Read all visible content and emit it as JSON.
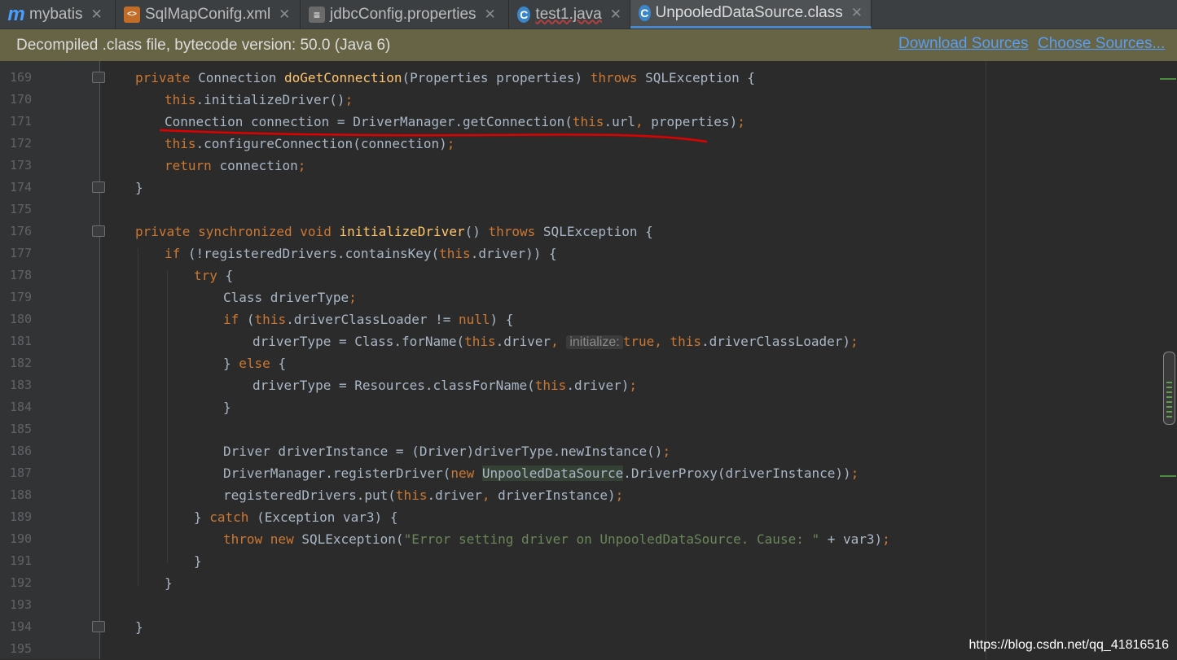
{
  "tabs": [
    {
      "icon": "m",
      "label": "mybatis",
      "active": false
    },
    {
      "icon": "<>",
      "label": "SqlMapConifg.xml",
      "active": false
    },
    {
      "icon": "≡",
      "label": "jdbcConfig.properties",
      "active": false
    },
    {
      "icon": "C",
      "label": "test1.java",
      "active": false
    },
    {
      "icon": "C",
      "label": "UnpooledDataSource.class",
      "active": true
    }
  ],
  "banner": {
    "message": "Decompiled .class file, bytecode version: 50.0 (Java 6)",
    "download_sources": "Download Sources",
    "choose_sources": "Choose Sources..."
  },
  "code": {
    "line_numbers": [
      "169",
      "170",
      "171",
      "172",
      "173",
      "174",
      "175",
      "176",
      "177",
      "178",
      "179",
      "180",
      "181",
      "182",
      "183",
      "184",
      "185",
      "186",
      "187",
      "188",
      "189",
      "190",
      "191",
      "192",
      "193",
      "194",
      "195"
    ],
    "l169": {
      "kw1": "private ",
      "t1": "Connection ",
      "fn": "doGetConnection",
      "t2": "(Properties properties) ",
      "kw2": "throws ",
      "t3": "SQLException {"
    },
    "l170": {
      "kw1": "this",
      "t1": ".initializeDriver()",
      "p": ";"
    },
    "l171": {
      "t1": "Connection connection = DriverManager.getConnection(",
      "kw1": "this",
      "t2": ".url",
      ",": ", ",
      "t3": "properties)",
      "p": ";"
    },
    "l172": {
      "kw1": "this",
      "t1": ".configureConnection(connection)",
      "p": ";"
    },
    "l173": {
      "kw1": "return ",
      "t1": "connection",
      "p": ";"
    },
    "l174": {
      "t1": "}"
    },
    "l176": {
      "kw1": "private synchronized void ",
      "fn": "initializeDriver",
      "t1": "() ",
      "kw2": "throws ",
      "t2": "SQLException {"
    },
    "l177": {
      "kw1": "if ",
      "t1": "(!registeredDrivers.containsKey(",
      "kw2": "this",
      "t2": ".driver)) {"
    },
    "l178": {
      "kw1": "try ",
      "t1": "{"
    },
    "l179": {
      "t1": "Class driverType",
      "p": ";"
    },
    "l180": {
      "kw1": "if ",
      "t1": "(",
      "kw2": "this",
      "t2": ".driverClassLoader != ",
      "kw3": "null",
      "t3": ") {"
    },
    "l181": {
      "t1": "driverType = Class.forName(",
      "kw1": "this",
      "t2": ".driver",
      ",": ", ",
      "hint": "initialize:",
      "kw2": "true",
      ",2": ", ",
      "kw3": "this",
      "t3": ".driverClassLoader)",
      "p": ";"
    },
    "l182": {
      "t1": "} ",
      "kw1": "else ",
      "t2": "{"
    },
    "l183": {
      "t1": "driverType = Resources.classForName(",
      "kw1": "this",
      "t2": ".driver)",
      "p": ";"
    },
    "l184": {
      "t1": "}"
    },
    "l186": {
      "t1": "Driver driverInstance = (Driver)driverType.newInstance()",
      "p": ";"
    },
    "l187": {
      "t1": "DriverManager.registerDriver(",
      "kw1": "new ",
      "hl": "UnpooledDataSource",
      "t2": ".DriverProxy(driverInstance))",
      "p": ";"
    },
    "l188": {
      "t1": "registeredDrivers.put(",
      "kw1": "this",
      "t2": ".driver",
      ",": ", ",
      "t3": "driverInstance)",
      "p": ";"
    },
    "l189": {
      "t1": "} ",
      "kw1": "catch ",
      "t2": "(Exception var3) {"
    },
    "l190": {
      "kw1": "throw new ",
      "t1": "SQLException(",
      "str": "\"Error setting driver on UnpooledDataSource. Cause: \"",
      "t2": " + var3)",
      "p": ";"
    },
    "l191": {
      "t1": "}"
    },
    "l192": {
      "t1": "}"
    },
    "l194": {
      "t1": "}"
    }
  },
  "watermark": "https://blog.csdn.net/qq_41816516",
  "colors": {
    "annotation_underline": "#e00000",
    "banner_bg": "#666445"
  }
}
